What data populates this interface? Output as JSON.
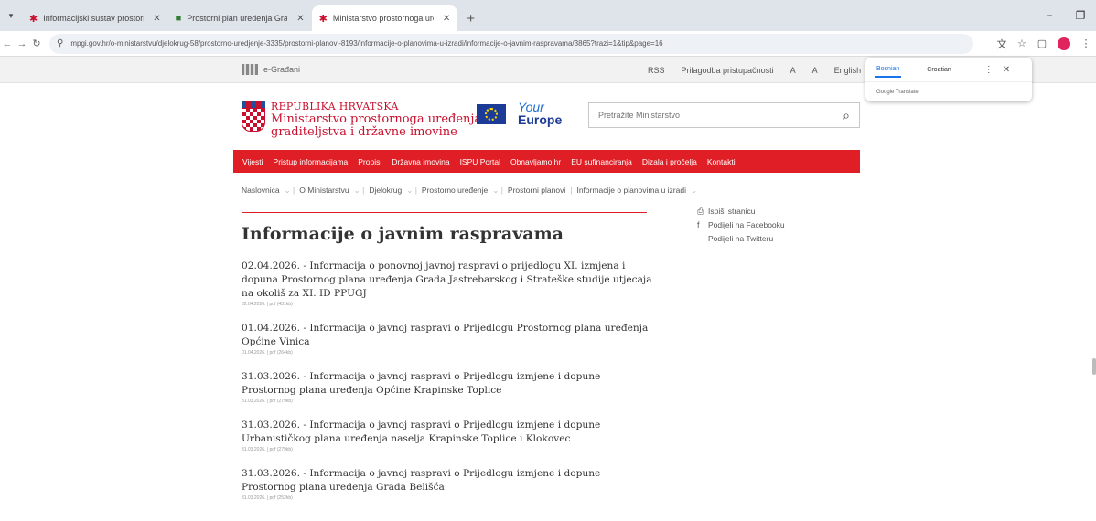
{
  "browser": {
    "tabs": [
      {
        "title": "Informacijski sustav prostornog",
        "active": false
      },
      {
        "title": "Prostorni plan uređenja Grada J",
        "active": false
      },
      {
        "title": "Ministarstvo prostornoga uređe",
        "active": true
      }
    ],
    "new_tab": "+",
    "url": "mpgi.gov.hr/o-ministarstvu/djelokrug-58/prostorno-uredjenje-3335/prostorni-planovi-8193/informacije-o-planovima-u-izradi/informacije-o-javnim-raspravama/3865?trazi=1&tip&page=16"
  },
  "topbar": {
    "egradani": "e-Građani",
    "links": [
      "RSS",
      "Prilagodba pristupačnosti",
      "A",
      "A",
      "English"
    ]
  },
  "header": {
    "logo_line1": "REPUBLIKA HRVATSKA",
    "logo_line2": "Ministarstvo prostornoga uređenja,",
    "logo_line3": "graditeljstva i državne imovine",
    "your": "Your",
    "europe": "Europe",
    "search_placeholder": "Pretražite Ministarstvo"
  },
  "mainnav": [
    "Vijesti",
    "Pristup informacijama",
    "Propisi",
    "Državna imovina",
    "ISPU Portal",
    "Obnavljamo.hr",
    "EU sufinanciranja",
    "Dizala i pročelja",
    "Kontakti"
  ],
  "breadcrumb": [
    "Naslovnica",
    "O Ministarstvu",
    "Djelokrug",
    "Prostorno uređenje",
    "Prostorni planovi",
    "Informacije o planovima u izradi"
  ],
  "page_title": "Informacije o javnim raspravama",
  "share": {
    "print": "Ispiši stranicu",
    "facebook": "Podijeli na Facebooku",
    "twitter": "Podijeli na Twitteru"
  },
  "items": [
    {
      "title": "02.04.2026. - Informacija o ponovnoj javnoj raspravi o prijedlogu XI. izmjena i dopuna Prostornog plana uređenja Grada Jastrebarskog i Strateške studije utjecaja na okoliš za XI. ID PPUGJ",
      "meta": "02.04.2026. | pdf (431kb)"
    },
    {
      "title": "01.04.2026. - Informacija o javnoj raspravi o Prijedlogu Prostornog plana uređenja Općine Vinica",
      "meta": "01.04.2026. | pdf (264kb)"
    },
    {
      "title": "31.03.2026. - Informacija o javnoj raspravi o Prijedlogu izmjene i dopune Prostornog plana uređenja Općine Krapinske Toplice",
      "meta": "31.03.2026. | pdf (279kb)"
    },
    {
      "title": "31.03.2026. - Informacija o javnoj raspravi o Prijedlogu izmjene i dopune Urbanističkog plana uređenja naselja Krapinske Toplice i Klokovec",
      "meta": "31.03.2026. | pdf (279kb)"
    },
    {
      "title": "31.03.2026. - Informacija o javnoj raspravi o Prijedlogu izmjene i dopune Prostornog plana uređenja Grada Belišća",
      "meta": "31.03.2026. | pdf (252kb)"
    }
  ],
  "translate": {
    "lang1": "Bosnian",
    "lang2": "Croatian",
    "label": "Google Translate"
  },
  "colors": {
    "accent_red": "#e01e25",
    "eu_blue": "#1c3b96"
  }
}
